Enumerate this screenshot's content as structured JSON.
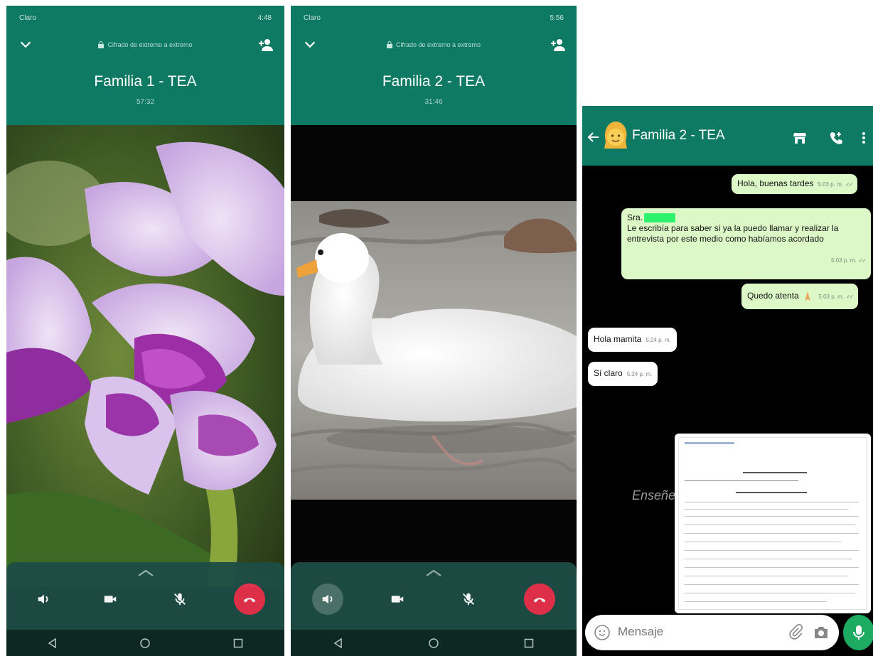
{
  "call1": {
    "status_left": "Claro",
    "status_right": "4:48",
    "encryption": "Cifrado de extremo a extremo",
    "name": "Familia 1 - TEA",
    "timer": "57:32"
  },
  "call2": {
    "status_left": "Claro",
    "status_right": "5:56",
    "encryption": "Cifrado de extremo a extremo",
    "name": "Familia 2 - TEA",
    "timer": "31:46"
  },
  "colors": {
    "whatsapp_green": "#0e7a63",
    "end_call_red": "#e6324b",
    "outgoing_bubble": "#dcf8c6"
  },
  "chat": {
    "title": "Familia 2 - TEA",
    "messages": [
      {
        "direction": "out",
        "text": "Hola, buenas tardes",
        "time": "5:03 p. m."
      },
      {
        "direction": "out",
        "line1": "Sra.",
        "line2": "Le escribía para saber si ya la puedo llamar y realizar la",
        "line3": "entrevista por este medio como habíamos acordado",
        "time": "5:03 p. m."
      },
      {
        "direction": "out",
        "text": "Quedo atenta",
        "time": "5:03 p. m."
      },
      {
        "direction": "in",
        "text": "Hola mamita",
        "time": "5:24 p. m."
      },
      {
        "direction": "in",
        "text": "Sí claro",
        "time": "5:24 p. m."
      }
    ],
    "caption_fragment": "Enseñel",
    "composer_placeholder": "Mensaje"
  }
}
